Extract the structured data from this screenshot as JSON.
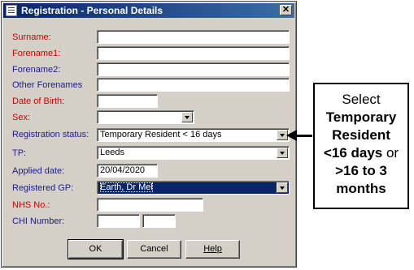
{
  "window": {
    "title": "Registration - Personal Details",
    "close_label": "✕"
  },
  "fields": {
    "surname": {
      "label": "Surname:",
      "value": ""
    },
    "forename1": {
      "label": "Forename1:",
      "value": ""
    },
    "forename2": {
      "label": "Forename2:",
      "value": ""
    },
    "other_forenames": {
      "label": "Other Forenames",
      "value": ""
    },
    "dob": {
      "label": "Date of Birth:",
      "value": ""
    },
    "sex": {
      "label": "Sex:",
      "value": ""
    },
    "registration_status": {
      "label": "Registration status:",
      "value": "Temporary Resident < 16 days"
    },
    "tp": {
      "label": "TP:",
      "value": "Leeds"
    },
    "applied_date": {
      "label": "Applied date:",
      "value": "20/04/2020"
    },
    "registered_gp": {
      "label": "Registered GP:",
      "value": "Earth, Dr Mel"
    },
    "nhs_no": {
      "label": "NHS No.:",
      "value": ""
    },
    "chi_number": {
      "label": "CHI Number:",
      "value": ""
    }
  },
  "buttons": {
    "ok": "OK",
    "cancel": "Cancel",
    "help": "Help"
  },
  "callout": {
    "line1": "Select",
    "line2": "Temporary",
    "line3": "Resident",
    "line4_bold": "<16 days",
    "line4_rest": " or",
    "line5": ">16 to 3",
    "line6": "months"
  },
  "colors": {
    "required_label": "#cc0000",
    "optional_label": "#1c1c8c",
    "titlebar": "#0a246a"
  }
}
